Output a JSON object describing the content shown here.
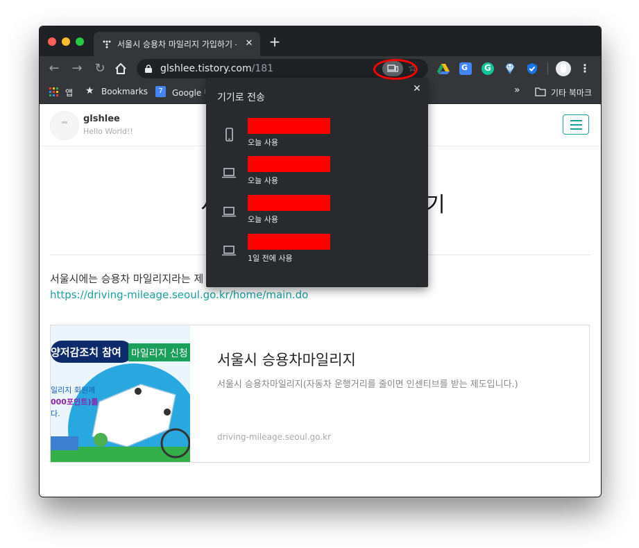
{
  "browser": {
    "tab_title": "서울시 승용차 마일리지 가입하기 - H",
    "tab_close": "✕",
    "new_tab": "+",
    "url_host": "glshlee.tistory.com",
    "url_path": "/181",
    "bookmarks": {
      "apps_label": "앱",
      "bookmarks_label": "Bookmarks",
      "google_label": "Google 캘",
      "calendar_badge": "7",
      "overflow": "»",
      "other_label": "기타 북마크"
    }
  },
  "send_to_device": {
    "title": "기기로 전송",
    "close": "✕",
    "devices": [
      {
        "icon": "phone-icon",
        "name": "",
        "status": "오늘 사용"
      },
      {
        "icon": "laptop-icon",
        "name": "",
        "status": "오늘 사용"
      },
      {
        "icon": "laptop-icon",
        "name": "",
        "status": "오늘 사용"
      },
      {
        "icon": "laptop-icon",
        "name": "",
        "status": "1일 전에 사용"
      }
    ],
    "redaction_color": "#ff0000",
    "annotation_color": "#ff0000"
  },
  "blog": {
    "name": "glshlee",
    "description": "Hello World!!",
    "title_left": "서",
    "title_right": "기",
    "body_text": "서울시에는 승용차 마일리지라는 제",
    "body_link": "https://driving-mileage.seoul.go.kr/home/main.do",
    "accent_color": "#1aa0a0"
  },
  "og_card": {
    "title": "서울시 승용차마일리지",
    "description": "서울시 승용차마일리지(자동차 운행거리를 줄이면 인센티브를 받는 제도입니다.)",
    "host": "driving-mileage.seoul.go.kr",
    "thumb_text_1": "양저감조치 참여",
    "thumb_text_2": "마일리지 신청",
    "thumb_text_3": "일리지 회원께",
    "thumb_text_4": "000포인트)를",
    "thumb_text_5": "다."
  }
}
